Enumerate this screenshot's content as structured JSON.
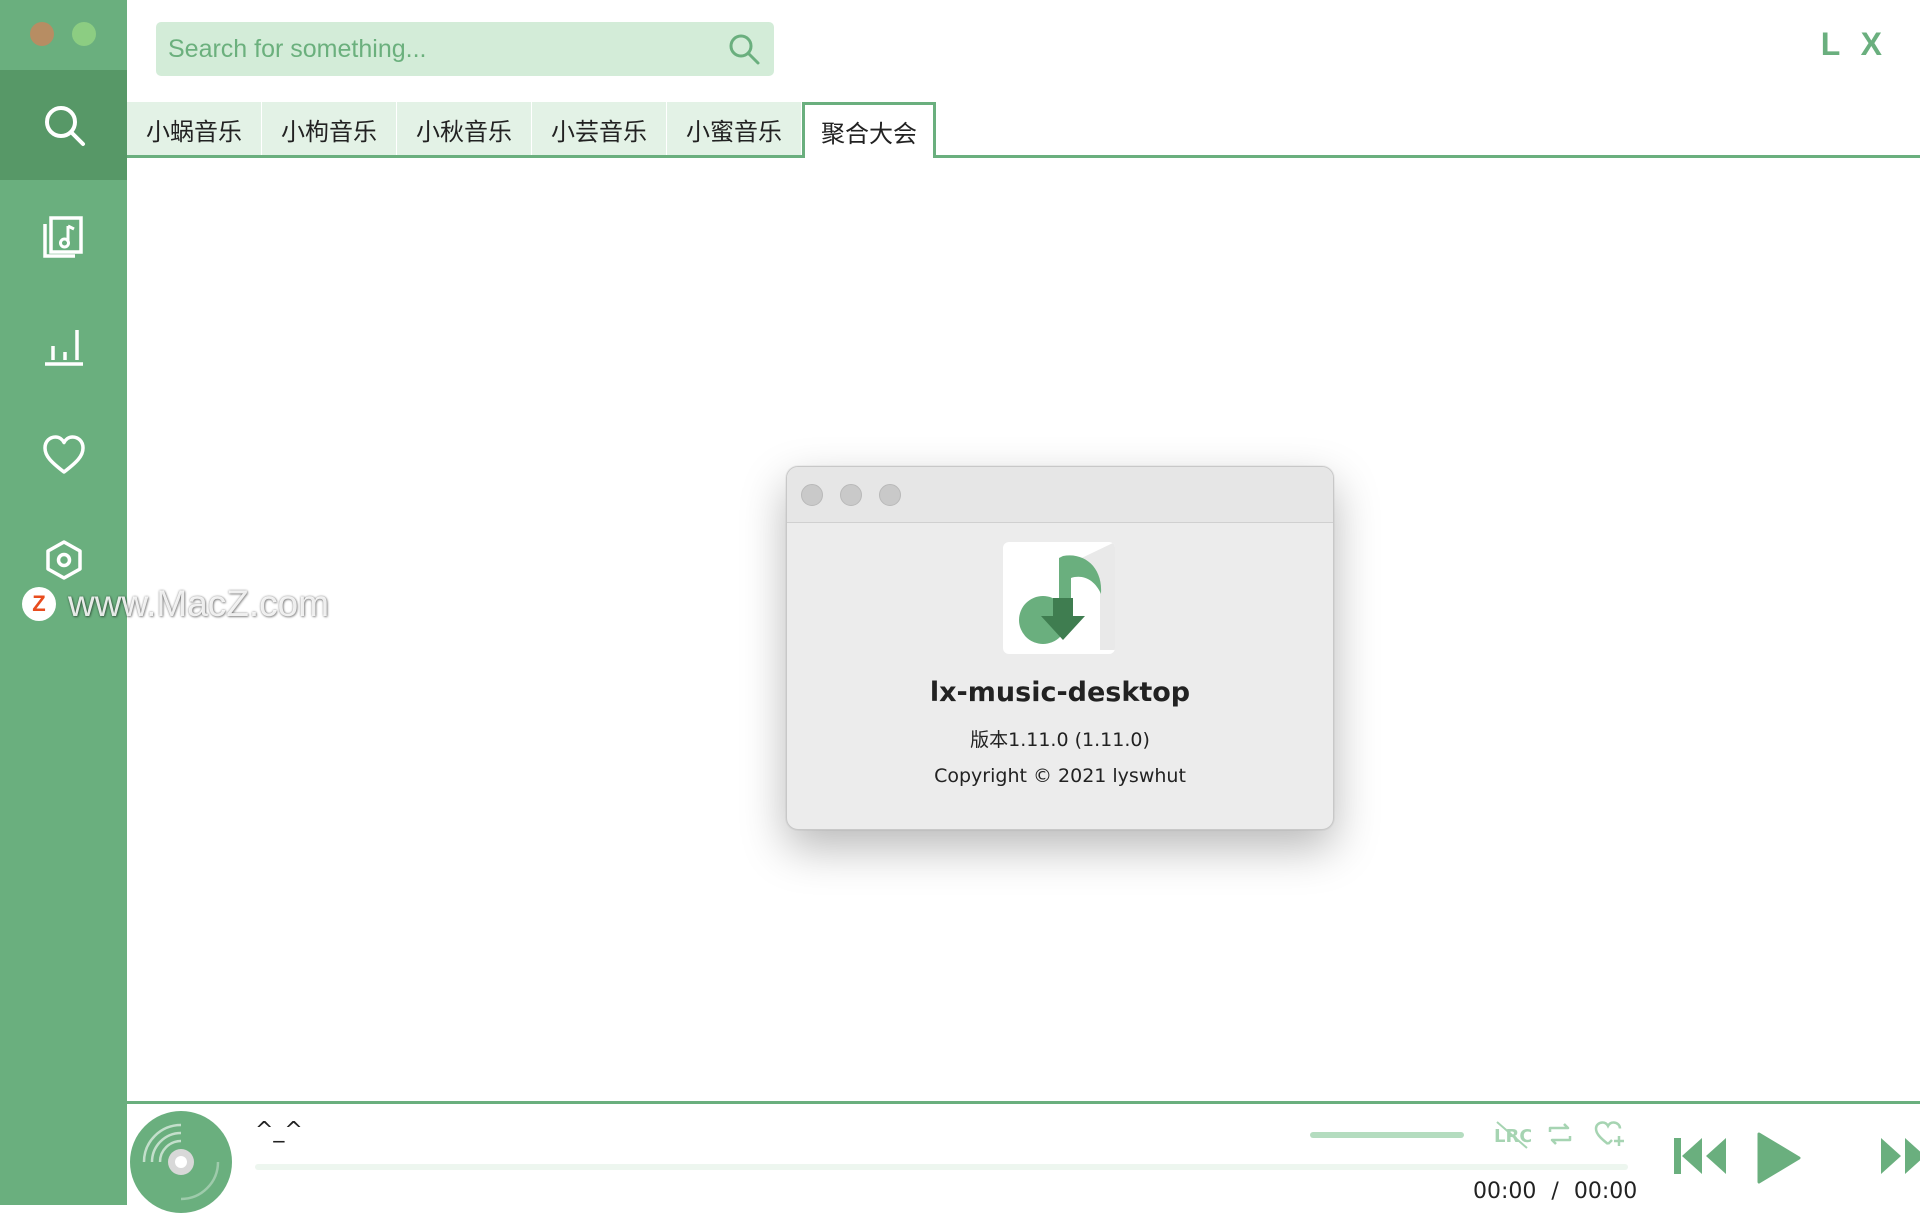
{
  "search": {
    "placeholder": "Search for something...",
    "value": ""
  },
  "brand": "L X",
  "tabs": [
    {
      "label": "小蜗音乐",
      "active": false
    },
    {
      "label": "小枸音乐",
      "active": false
    },
    {
      "label": "小秋音乐",
      "active": false
    },
    {
      "label": "小芸音乐",
      "active": false
    },
    {
      "label": "小蜜音乐",
      "active": false
    },
    {
      "label": "聚合大会",
      "active": true
    }
  ],
  "sidebar": {
    "items": [
      {
        "icon": "search-icon",
        "active": true
      },
      {
        "icon": "music-playlist-icon",
        "active": false
      },
      {
        "icon": "leaderboard-icon",
        "active": false
      },
      {
        "icon": "heart-icon",
        "active": false
      },
      {
        "icon": "settings-icon",
        "active": false
      }
    ]
  },
  "watermark": {
    "logo_letter": "Z",
    "text": "www.MacZ.com"
  },
  "about_dialog": {
    "app_name": "lx-music-desktop",
    "version": "版本1.11.0 (1.11.0)",
    "copyright": "Copyright © 2021 lyswhut"
  },
  "player": {
    "title": "^_^",
    "time_current": "00:00",
    "time_separator": "/",
    "time_total": "00:00",
    "progress": 0,
    "volume": 1.0,
    "controls": [
      "lyrics-icon",
      "repeat-icon",
      "favorite-add-icon",
      "previous-icon",
      "play-icon",
      "next-icon"
    ]
  },
  "colors": {
    "accent": "#6aaf7e",
    "accent_dark": "#579867",
    "search_bg": "#d3ecd8",
    "tab_bg": "#e3f2e6"
  }
}
